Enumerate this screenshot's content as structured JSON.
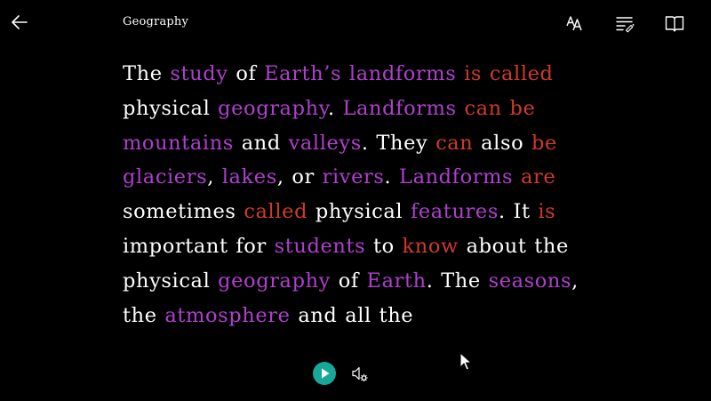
{
  "header": {
    "title": "Geography",
    "back_icon": "back-arrow-icon",
    "text_preferences_icon": "text-size-icon",
    "grammar_options_icon": "grammar-options-icon",
    "reading_preferences_icon": "book-icon"
  },
  "colors": {
    "background": "#000000",
    "text": "#ffffff",
    "noun": "#b03fd0",
    "verb": "#d03a2a",
    "play_button": "#17a89a"
  },
  "reading": {
    "tokens": [
      {
        "t": "The ",
        "c": "p"
      },
      {
        "t": "study",
        "c": "n"
      },
      {
        "t": " of ",
        "c": "p"
      },
      {
        "t": "Earth’s landforms",
        "c": "n"
      },
      {
        "t": " ",
        "c": "p"
      },
      {
        "t": "is called",
        "c": "v"
      },
      {
        "t": " physical ",
        "c": "p"
      },
      {
        "t": "geography",
        "c": "n"
      },
      {
        "t": ". ",
        "c": "p"
      },
      {
        "t": "Landforms",
        "c": "n"
      },
      {
        "t": " ",
        "c": "p"
      },
      {
        "t": "can be",
        "c": "v"
      },
      {
        "t": " ",
        "c": "p"
      },
      {
        "t": "mountains",
        "c": "n"
      },
      {
        "t": " and ",
        "c": "p"
      },
      {
        "t": "valleys",
        "c": "n"
      },
      {
        "t": ". They ",
        "c": "p"
      },
      {
        "t": "can",
        "c": "v"
      },
      {
        "t": " also ",
        "c": "p"
      },
      {
        "t": "be",
        "c": "v"
      },
      {
        "t": " ",
        "c": "p"
      },
      {
        "t": "glaciers",
        "c": "n"
      },
      {
        "t": ", ",
        "c": "p"
      },
      {
        "t": "lakes",
        "c": "n"
      },
      {
        "t": ", or ",
        "c": "p"
      },
      {
        "t": "rivers",
        "c": "n"
      },
      {
        "t": ". ",
        "c": "p"
      },
      {
        "t": "Landforms",
        "c": "n"
      },
      {
        "t": " ",
        "c": "p"
      },
      {
        "t": "are",
        "c": "v"
      },
      {
        "t": " sometimes ",
        "c": "p"
      },
      {
        "t": "called",
        "c": "v"
      },
      {
        "t": " physical ",
        "c": "p"
      },
      {
        "t": "features",
        "c": "n"
      },
      {
        "t": ". It ",
        "c": "p"
      },
      {
        "t": "is",
        "c": "v"
      },
      {
        "t": " important for ",
        "c": "p"
      },
      {
        "t": "students",
        "c": "n"
      },
      {
        "t": " to ",
        "c": "p"
      },
      {
        "t": "know",
        "c": "v"
      },
      {
        "t": " about the physical ",
        "c": "p"
      },
      {
        "t": "geography",
        "c": "n"
      },
      {
        "t": " of ",
        "c": "p"
      },
      {
        "t": "Earth",
        "c": "n"
      },
      {
        "t": ". The ",
        "c": "p"
      },
      {
        "t": "seasons",
        "c": "n"
      },
      {
        "t": ", the ",
        "c": "p"
      },
      {
        "t": "atmosphere",
        "c": "n"
      },
      {
        "t": " and all the",
        "c": "p"
      }
    ]
  },
  "footer": {
    "play_icon": "play-icon",
    "voice_settings_icon": "voice-settings-icon"
  }
}
